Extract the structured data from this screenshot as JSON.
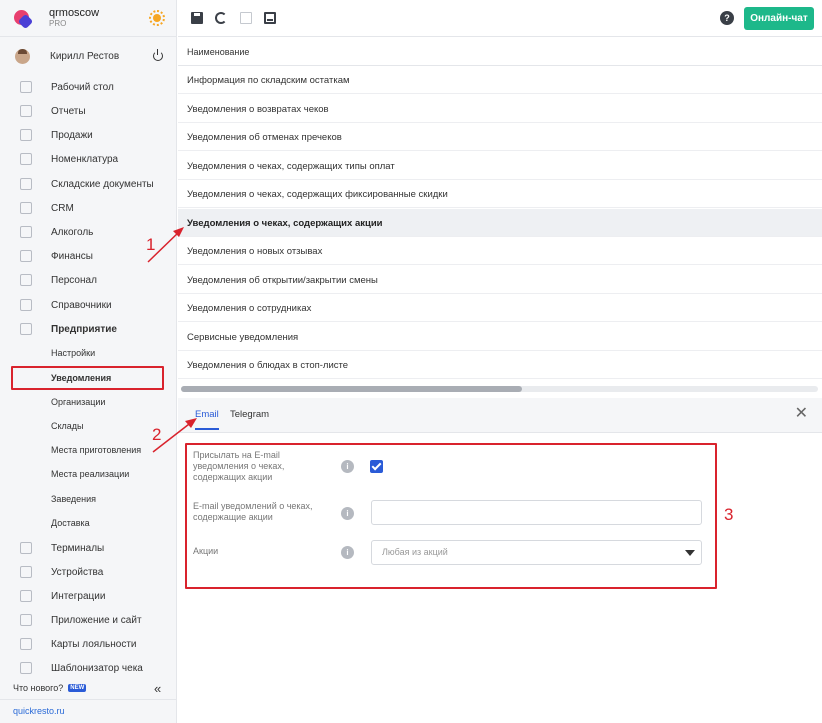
{
  "brand": {
    "name": "qrmoscow",
    "plan": "PRO"
  },
  "user": {
    "name": "Кирилл Рестов"
  },
  "sidebar": {
    "items": [
      {
        "label": "Рабочий стол"
      },
      {
        "label": "Отчеты"
      },
      {
        "label": "Продажи"
      },
      {
        "label": "Номенклатура"
      },
      {
        "label": "Складские документы"
      },
      {
        "label": "CRM"
      },
      {
        "label": "Алкоголь"
      },
      {
        "label": "Финансы"
      },
      {
        "label": "Персонал"
      },
      {
        "label": "Справочники"
      },
      {
        "label": "Предприятие"
      }
    ],
    "subitems": [
      {
        "label": "Настройки"
      },
      {
        "label": "Уведомления"
      },
      {
        "label": "Организации"
      },
      {
        "label": "Склады"
      },
      {
        "label": "Места приготовления"
      },
      {
        "label": "Места реализации"
      },
      {
        "label": "Заведения"
      },
      {
        "label": "Доставка"
      }
    ],
    "items2": [
      {
        "label": "Терминалы"
      },
      {
        "label": "Устройства"
      },
      {
        "label": "Интеграции"
      },
      {
        "label": "Приложение и сайт"
      },
      {
        "label": "Карты лояльности"
      },
      {
        "label": "Шаблонизатор чека"
      }
    ],
    "whats_new": "Что нового?",
    "new_badge": "NEW",
    "collapse": "«",
    "site": "quickresto.ru"
  },
  "toolbar": {
    "help": "?",
    "chat": "Онлайн-чат"
  },
  "table": {
    "header": "Наименование",
    "rows": [
      "Информация по складским остаткам",
      "Уведомления о возвратах чеков",
      "Уведомления об отменах пречеков",
      "Уведомления о чеках, содержащих типы оплат",
      "Уведомления о чеках, содержащих фиксированные скидки",
      "Уведомления о чеках, содержащих акции",
      "Уведомления о новых отзывах",
      "Уведомления об открытии/закрытии смены",
      "Уведомления о сотрудниках",
      "Сервисные уведомления",
      "Уведомления о блюдах в стоп-листе"
    ],
    "selected_index": 5
  },
  "tabs": {
    "email": "Email",
    "telegram": "Telegram",
    "close": "✕"
  },
  "form": {
    "send_label": "Присылать на E-mail уведомления о чеках, содержащих акции",
    "email_label": "E-mail уведомлений о чеках, содержащие акции",
    "email_value": "",
    "promo_label": "Акции",
    "promo_placeholder": "Любая из акций",
    "send_checked": true,
    "info": "i"
  },
  "callouts": {
    "one": "1",
    "two": "2",
    "three": "3"
  },
  "colors": {
    "accent": "#2a5bd7",
    "chat": "#1db88a",
    "annotation": "#d9232d"
  }
}
